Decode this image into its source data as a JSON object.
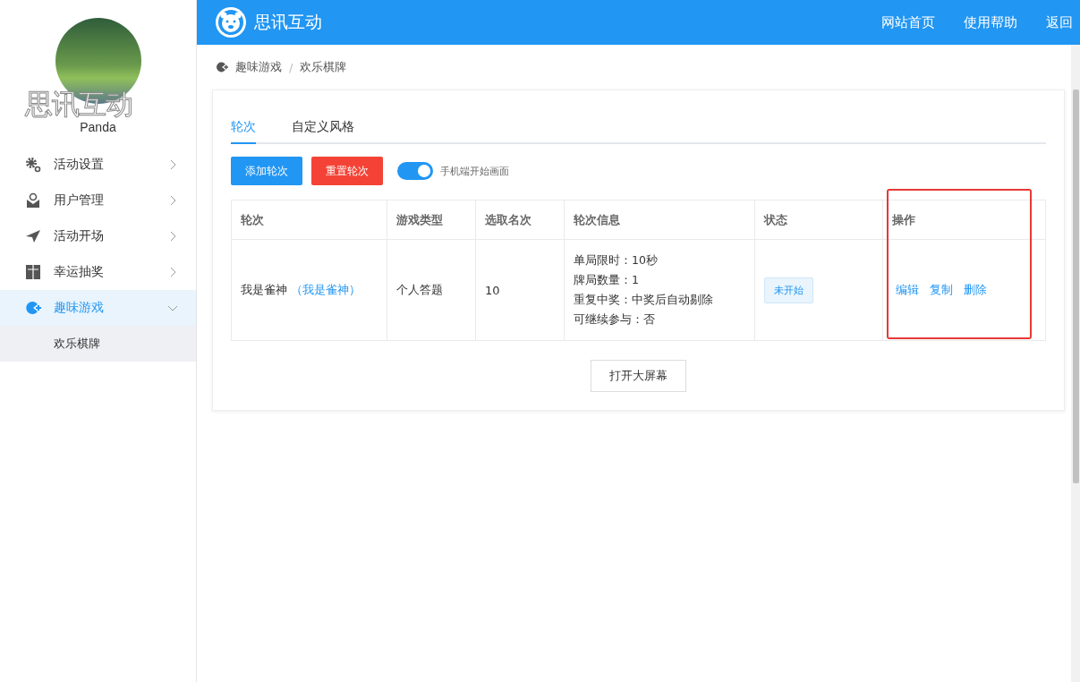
{
  "sidebar": {
    "brand_overlay": "思讯互动",
    "user_name": "Panda",
    "menu": [
      {
        "label": "活动设置",
        "expanded": false,
        "selected": false
      },
      {
        "label": "用户管理",
        "expanded": false,
        "selected": false
      },
      {
        "label": "活动开场",
        "expanded": false,
        "selected": false
      },
      {
        "label": "幸运抽奖",
        "expanded": false,
        "selected": false
      },
      {
        "label": "趣味游戏",
        "expanded": true,
        "selected": true,
        "children": [
          {
            "label": "欢乐棋牌",
            "selected": true
          }
        ]
      }
    ]
  },
  "header": {
    "logo_text": "思讯互动",
    "nav": [
      "网站首页",
      "使用帮助",
      "返回"
    ]
  },
  "breadcrumb": [
    "趣味游戏",
    "欢乐棋牌"
  ],
  "breadcrumb_separator": "/",
  "tabs": [
    {
      "label": "轮次",
      "selected": true
    },
    {
      "label": "自定义风格",
      "selected": false
    }
  ],
  "toolbar": {
    "buttons": [
      {
        "label": "添加轮次",
        "kind": "primary"
      },
      {
        "label": "重置轮次",
        "kind": "danger"
      }
    ],
    "toggle": {
      "label": "手机端开始画面",
      "on": true
    }
  },
  "table": {
    "columns": [
      "轮次",
      "游戏类型",
      "选取名次",
      "轮次信息",
      "状态",
      "操作"
    ],
    "rows": [
      {
        "round": "我是雀神",
        "round_link": "（我是雀神）",
        "game_type": "个人答题",
        "rank_count": "10",
        "info": [
          "单局限时：10秒",
          "牌局数量：1",
          "重复中奖：中奖后自动剔除",
          "可继续参与：否"
        ],
        "status": "未开始",
        "actions": [
          "编辑",
          "复制",
          "删除"
        ]
      }
    ]
  },
  "footer_button": "打开大屏幕"
}
